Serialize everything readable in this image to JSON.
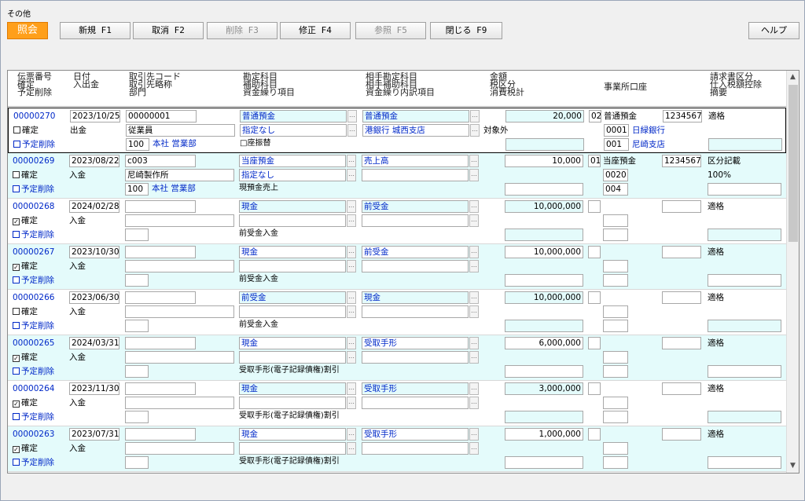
{
  "window": {
    "title": "その他"
  },
  "toolbar": {
    "mode": "照会",
    "new": "新規 F1",
    "cancel": "取消 F2",
    "delete": "削除 F3",
    "modify": "修正 F4",
    "ref": "参照 F5",
    "close": "閉じる F9",
    "help": "ヘルプ"
  },
  "headers": {
    "c1": "伝票番号\n確定\n予定削除",
    "c2": "日付\n入出金",
    "c3": "取引先コード\n取引先略称\n部門",
    "c4": "勘定科目\n補助科目\n資金繰り項目",
    "c5": "相手勘定科目\n相手補助科目\n資金繰り内訳項目",
    "c6": "金額\n税区分\n消費税計",
    "c7": "事業所口座",
    "c8": "請求書区分\n仕入税額控除\n摘要"
  },
  "labels": {
    "confirm": "確定",
    "delete": "予定削除"
  },
  "rows": [
    {
      "no": "00000270",
      "date": "2023/10/25",
      "io": "出金",
      "partner": "00000001",
      "partner_name": "従業員",
      "dept_code": "100",
      "dept": "本社 営業部",
      "acct": "普通預金",
      "sub": "指定なし",
      "cash": "□座振替",
      "pacct": "普通預金",
      "psub": "港銀行 城西支店",
      "amount": "20,000",
      "tax": "対象外",
      "office": "02",
      "account_type": "普通預金",
      "account_no": "1234567",
      "bank_code": "0001",
      "bank": "日緑銀行",
      "branch_code": "001",
      "branch": "尼崎支店",
      "invoice": "適格",
      "deduction": "",
      "confirmed": false,
      "cyan": false
    },
    {
      "no": "00000269",
      "date": "2023/08/22",
      "io": "入金",
      "partner": "c003",
      "partner_name": "尼崎製作所",
      "dept_code": "100",
      "dept": "本社 営業部",
      "acct": "当座預金",
      "sub": "指定なし",
      "cash": "現預金売上",
      "pacct": "売上高",
      "psub": "",
      "amount": "10,000",
      "tax": "",
      "office": "01",
      "account_type": "当座預金",
      "account_no": "1234567",
      "bank_code": "0020",
      "bank": "",
      "branch_code": "004",
      "branch": "",
      "invoice": "区分記載",
      "deduction": "100%",
      "confirmed": false,
      "cyan": true
    },
    {
      "no": "00000268",
      "date": "2024/02/28",
      "io": "入金",
      "partner": "",
      "partner_name": "",
      "dept_code": "",
      "dept": "",
      "acct": "現金",
      "sub": "",
      "cash": "前受金入金",
      "pacct": "前受金",
      "psub": "",
      "amount": "10,000,000",
      "tax": "",
      "office": "",
      "account_type": "",
      "account_no": "",
      "bank_code": "",
      "bank": "",
      "branch_code": "",
      "branch": "",
      "invoice": "適格",
      "deduction": "",
      "confirmed": true,
      "cyan": false
    },
    {
      "no": "00000267",
      "date": "2023/10/30",
      "io": "入金",
      "partner": "",
      "partner_name": "",
      "dept_code": "",
      "dept": "",
      "acct": "現金",
      "sub": "",
      "cash": "前受金入金",
      "pacct": "前受金",
      "psub": "",
      "amount": "10,000,000",
      "tax": "",
      "office": "",
      "account_type": "",
      "account_no": "",
      "bank_code": "",
      "bank": "",
      "branch_code": "",
      "branch": "",
      "invoice": "適格",
      "deduction": "",
      "confirmed": true,
      "cyan": true
    },
    {
      "no": "00000266",
      "date": "2023/06/30",
      "io": "入金",
      "partner": "",
      "partner_name": "",
      "dept_code": "",
      "dept": "",
      "acct": "前受金",
      "sub": "",
      "cash": "前受金入金",
      "pacct": "現金",
      "psub": "",
      "amount": "10,000,000",
      "tax": "",
      "office": "",
      "account_type": "",
      "account_no": "",
      "bank_code": "",
      "bank": "",
      "branch_code": "",
      "branch": "",
      "invoice": "適格",
      "deduction": "",
      "confirmed": false,
      "cyan": false
    },
    {
      "no": "00000265",
      "date": "2024/03/31",
      "io": "入金",
      "partner": "",
      "partner_name": "",
      "dept_code": "",
      "dept": "",
      "acct": "現金",
      "sub": "",
      "cash": "受取手形(電子記録債権)割引",
      "pacct": "受取手形",
      "psub": "",
      "amount": "6,000,000",
      "tax": "",
      "office": "",
      "account_type": "",
      "account_no": "",
      "bank_code": "",
      "bank": "",
      "branch_code": "",
      "branch": "",
      "invoice": "適格",
      "deduction": "",
      "confirmed": true,
      "cyan": true
    },
    {
      "no": "00000264",
      "date": "2023/11/30",
      "io": "入金",
      "partner": "",
      "partner_name": "",
      "dept_code": "",
      "dept": "",
      "acct": "現金",
      "sub": "",
      "cash": "受取手形(電子記録債権)割引",
      "pacct": "受取手形",
      "psub": "",
      "amount": "3,000,000",
      "tax": "",
      "office": "",
      "account_type": "",
      "account_no": "",
      "bank_code": "",
      "bank": "",
      "branch_code": "",
      "branch": "",
      "invoice": "適格",
      "deduction": "",
      "confirmed": true,
      "cyan": false
    },
    {
      "no": "00000263",
      "date": "2023/07/31",
      "io": "入金",
      "partner": "",
      "partner_name": "",
      "dept_code": "",
      "dept": "",
      "acct": "現金",
      "sub": "",
      "cash": "受取手形(電子記録債権)割引",
      "pacct": "受取手形",
      "psub": "",
      "amount": "1,000,000",
      "tax": "",
      "office": "",
      "account_type": "",
      "account_no": "",
      "bank_code": "",
      "bank": "",
      "branch_code": "",
      "branch": "",
      "invoice": "適格",
      "deduction": "",
      "confirmed": true,
      "cyan": true
    }
  ]
}
